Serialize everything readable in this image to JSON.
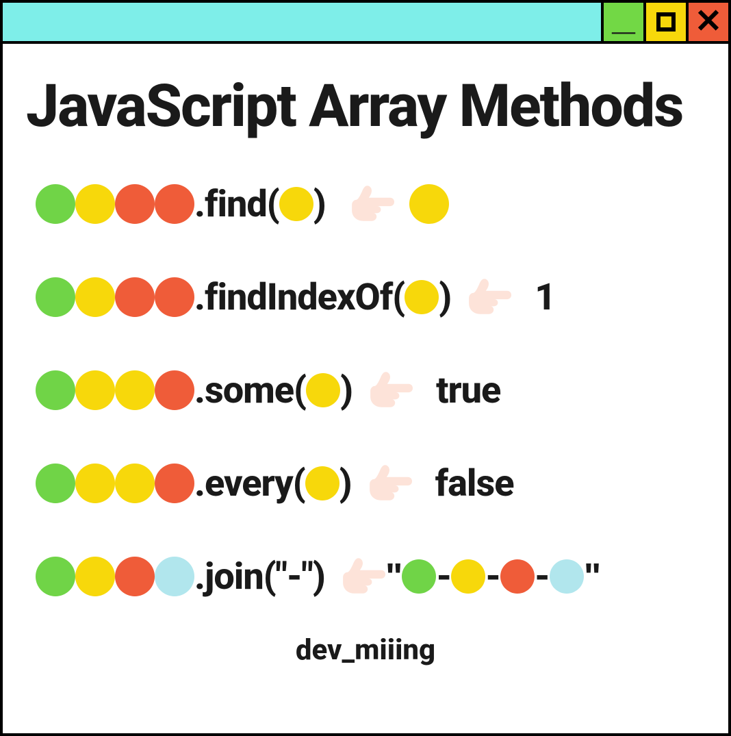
{
  "title": "JavaScript Array Methods",
  "footer": "dev_miiing",
  "colors": {
    "green": "#70d447",
    "yellow": "#f7d80b",
    "red": "#ef5c39",
    "cyan": "#b1e6ed",
    "titlebar": "#7eeee9",
    "min": "#72d845",
    "max": "#f7d80b",
    "close": "#ef5c39"
  },
  "titlebar_buttons": {
    "min": "_",
    "max": "▢",
    "close": "✕"
  },
  "rows": [
    {
      "input_dots": [
        "green",
        "yellow",
        "red",
        "red"
      ],
      "method": ".find",
      "arg_type": "dot",
      "arg_dot": "yellow",
      "arg_text": "",
      "result_type": "dot",
      "result_dots": [
        "yellow"
      ],
      "result_text": ""
    },
    {
      "input_dots": [
        "green",
        "yellow",
        "red",
        "red"
      ],
      "method": ".findIndexOf",
      "arg_type": "dot",
      "arg_dot": "yellow",
      "arg_text": "",
      "result_type": "text",
      "result_dots": [],
      "result_text": "1"
    },
    {
      "input_dots": [
        "green",
        "yellow",
        "yellow",
        "red"
      ],
      "method": ".some",
      "arg_type": "dot",
      "arg_dot": "yellow",
      "arg_text": "",
      "result_type": "text",
      "result_dots": [],
      "result_text": "true"
    },
    {
      "input_dots": [
        "green",
        "yellow",
        "yellow",
        "red"
      ],
      "method": ".every",
      "arg_type": "dot",
      "arg_dot": "yellow",
      "arg_text": "",
      "result_type": "text",
      "result_dots": [],
      "result_text": "false"
    },
    {
      "input_dots": [
        "green",
        "yellow",
        "red",
        "cyan"
      ],
      "method": ".join",
      "arg_type": "text",
      "arg_dot": "",
      "arg_text": "\"-\"",
      "result_type": "joined",
      "result_dots": [
        "green",
        "yellow",
        "red",
        "cyan"
      ],
      "result_text": "-"
    }
  ]
}
